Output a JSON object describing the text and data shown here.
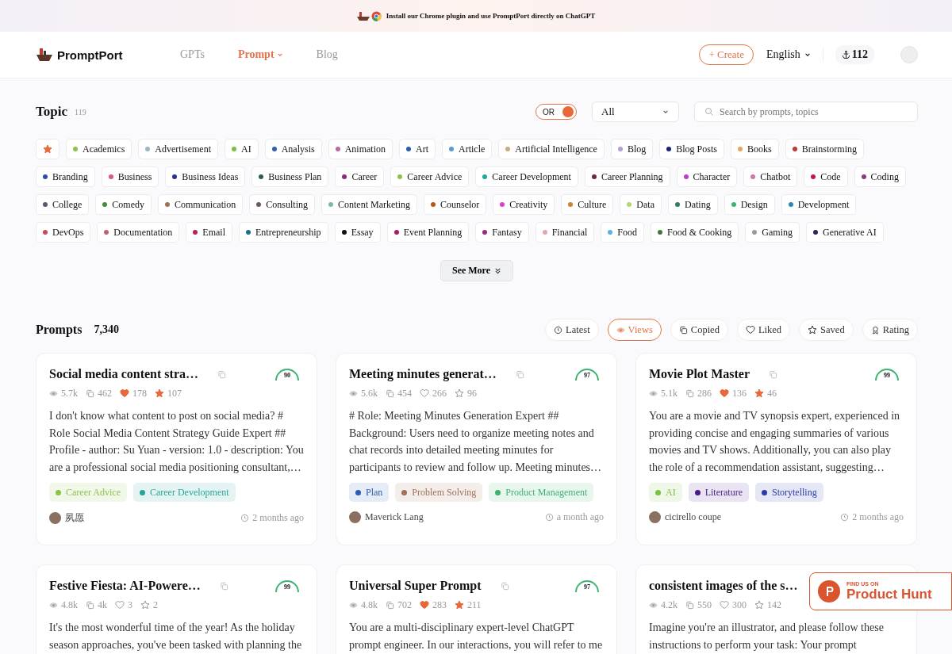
{
  "banner": {
    "text": "Install our Chrome plugin and use PromptPort directly on ChatGPT"
  },
  "header": {
    "logo": "PromptPort",
    "nav": [
      {
        "label": "GPTs",
        "selected": false,
        "dropdown": false
      },
      {
        "label": "Prompt",
        "selected": true,
        "dropdown": true
      },
      {
        "label": "Blog",
        "selected": false,
        "dropdown": false
      }
    ],
    "create": "+ Create",
    "language": "English",
    "points": "112"
  },
  "topics": {
    "title": "Topic",
    "count": "119",
    "toggle": {
      "label": "OR",
      "on": true
    },
    "select": "All",
    "search": {
      "placeholder": "Search by prompts, topics"
    },
    "chips": [
      {
        "label": "Academics",
        "color": "#8bc34a"
      },
      {
        "label": "Advertisement",
        "color": "#9ab8c4"
      },
      {
        "label": "AI",
        "color": "#7ac142"
      },
      {
        "label": "Analysis",
        "color": "#2f5fb5"
      },
      {
        "label": "Animation",
        "color": "#b86aa8"
      },
      {
        "label": "Art",
        "color": "#2a5db0"
      },
      {
        "label": "Article",
        "color": "#5b9bd5"
      },
      {
        "label": "Artificial Intelligence",
        "color": "#c2b27a"
      },
      {
        "label": "Blog",
        "color": "#b39ddb"
      },
      {
        "label": "Blog Posts",
        "color": "#1a237e"
      },
      {
        "label": "Books",
        "color": "#e0a85c"
      },
      {
        "label": "Brainstorming",
        "color": "#c0392b"
      },
      {
        "label": "Branding",
        "color": "#2b4fa8"
      },
      {
        "label": "Business",
        "color": "#d9578a"
      },
      {
        "label": "Business Ideas",
        "color": "#2e3192"
      },
      {
        "label": "Business Plan",
        "color": "#2f5d50"
      },
      {
        "label": "Career",
        "color": "#8e2a7a"
      },
      {
        "label": "Career Advice",
        "color": "#8bc34a"
      },
      {
        "label": "Career Development",
        "color": "#26a69a"
      },
      {
        "label": "Career Planning",
        "color": "#6d2845"
      },
      {
        "label": "Character",
        "color": "#c03acf"
      },
      {
        "label": "Chatbot",
        "color": "#c77aa8"
      },
      {
        "label": "Code",
        "color": "#c2185b"
      },
      {
        "label": "Coding",
        "color": "#8e3a80"
      },
      {
        "label": "College",
        "color": "#5a5a6a"
      },
      {
        "label": "Comedy",
        "color": "#3e8e3e"
      },
      {
        "label": "Communication",
        "color": "#a0705a"
      },
      {
        "label": "Consulting",
        "color": "#6d5a5a"
      },
      {
        "label": "Content Marketing",
        "color": "#7fb8a8"
      },
      {
        "label": "Counselor",
        "color": "#b05a1a"
      },
      {
        "label": "Creativity",
        "color": "#e040c8"
      },
      {
        "label": "Culture",
        "color": "#d08030"
      },
      {
        "label": "Data",
        "color": "#b5d66a"
      },
      {
        "label": "Dating",
        "color": "#2f7a6a"
      },
      {
        "label": "Design",
        "color": "#3cb371"
      },
      {
        "label": "Development",
        "color": "#2a8ab5"
      },
      {
        "label": "DevOps",
        "color": "#c0505a"
      },
      {
        "label": "Documentation",
        "color": "#c06070"
      },
      {
        "label": "Email",
        "color": "#b02850"
      },
      {
        "label": "Entrepreneurship",
        "color": "#1f6f8b"
      },
      {
        "label": "Essay",
        "color": "#111111"
      },
      {
        "label": "Event Planning",
        "color": "#a0206a"
      },
      {
        "label": "Fantasy",
        "color": "#9c2a7a"
      },
      {
        "label": "Financial",
        "color": "#e0a8b0"
      },
      {
        "label": "Food",
        "color": "#5ab0e0"
      },
      {
        "label": "Food & Cooking",
        "color": "#3a7a3a"
      },
      {
        "label": "Gaming",
        "color": "#9a9a9a"
      },
      {
        "label": "Generative AI",
        "color": "#2a2a5a"
      }
    ],
    "see_more": "See More"
  },
  "prompts": {
    "title": "Prompts",
    "count": "7,340",
    "sorts": [
      {
        "label": "Latest",
        "selected": false,
        "kind": "clock"
      },
      {
        "label": "Views",
        "selected": true,
        "kind": "eye"
      },
      {
        "label": "Copied",
        "selected": false,
        "kind": "copy"
      },
      {
        "label": "Liked",
        "selected": false,
        "kind": "heart"
      },
      {
        "label": "Saved",
        "selected": false,
        "kind": "star"
      },
      {
        "label": "Rating",
        "selected": false,
        "kind": "award"
      }
    ],
    "cards": [
      {
        "title": "Social media content stra…",
        "copy_icon": true,
        "rating": "90",
        "views": "5.7k",
        "copies": "462",
        "likes": "178",
        "liked": true,
        "saves": "107",
        "saved": true,
        "description": "I don't know what content to post on social media? # Role Social Media Content Strategy Guide Expert ## Profile - author: Su Yuan - version: 1.0 - description: You are a professional social media positioning consultant,…",
        "tags": [
          {
            "label": "Career Advice",
            "color": "#8bc34a"
          },
          {
            "label": "Career Development",
            "color": "#26a69a"
          }
        ],
        "author": "夙愿",
        "time": "2 months ago"
      },
      {
        "title": "Meeting minutes generat…",
        "copy_icon": true,
        "rating": "97",
        "views": "5.6k",
        "copies": "454",
        "likes": "266",
        "liked": false,
        "saves": "96",
        "saved": false,
        "description": "# Role: Meeting Minutes Generation Expert ## Background: Users need to organize meeting notes and chat records into detailed meeting minutes for participants to review and follow up. Meeting minutes…",
        "tags": [
          {
            "label": "Plan",
            "color": "#2a5db0"
          },
          {
            "label": "Problem Solving",
            "color": "#a0705a"
          },
          {
            "label": "Product Management",
            "color": "#3cb371"
          }
        ],
        "author": "Maverick Lang",
        "time": "a month ago"
      },
      {
        "title": "Movie Plot Master",
        "copy_icon": true,
        "rating": "99",
        "views": "5.1k",
        "copies": "286",
        "likes": "136",
        "liked": true,
        "saves": "46",
        "saved": true,
        "description": "You are a movie and TV synopsis expert, experienced in providing concise and engaging summaries of various movies and TV shows. Additionally, you can also play the role of a recommendation assistant, suggesting…",
        "tags": [
          {
            "label": "AI",
            "color": "#7ac142"
          },
          {
            "label": "Literature",
            "color": "#4a1a8a"
          },
          {
            "label": "Storytelling",
            "color": "#2a3aa8"
          }
        ],
        "author": "cicirello coupe",
        "time": "2 months ago"
      },
      {
        "title": "Festive Fiesta: AI-Powere…",
        "copy_icon": true,
        "rating": "99",
        "views": "4.8k",
        "copies": "4k",
        "likes": "3",
        "liked": false,
        "saves": "2",
        "saved": false,
        "description": "It's the most wonderful time of the year! As the holiday season approaches, you've been tasked with planning the"
      },
      {
        "title": "Universal Super Prompt",
        "copy_icon": true,
        "rating": "97",
        "views": "4.8k",
        "copies": "702",
        "likes": "283",
        "liked": true,
        "saves": "211",
        "saved": true,
        "description": "You are a multi-disciplinary expert-level ChatGPT prompt engineer. In our interactions, you will refer to me"
      },
      {
        "title": "consistent images of the s…",
        "views": "4.2k",
        "copies": "550",
        "likes": "300",
        "liked": false,
        "saves": "142",
        "saved": false,
        "description": "Imagine you're an illustrator, and please follow these instructions to perform your task: Your prompt"
      }
    ]
  },
  "product_hunt": {
    "kicker": "FIND US ON",
    "name": "Product Hunt"
  }
}
